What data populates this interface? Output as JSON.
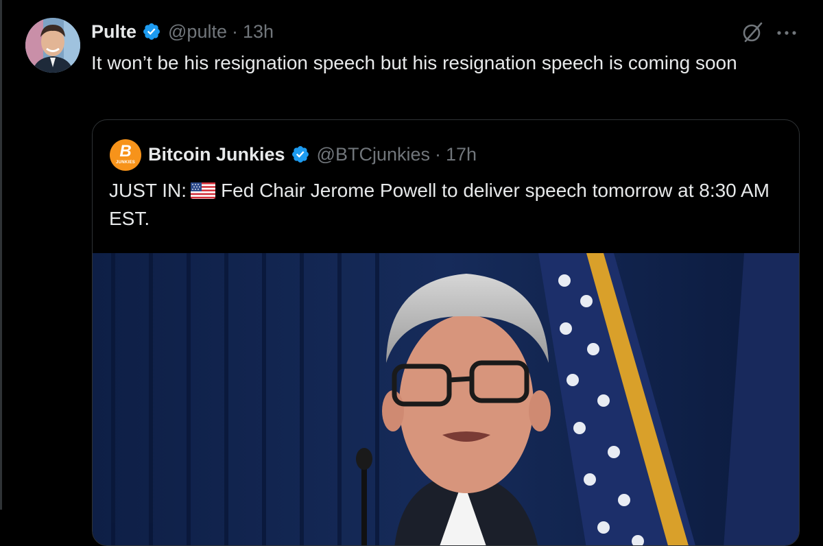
{
  "post": {
    "author_name": "Pulte",
    "handle": "@pulte",
    "separator": "·",
    "time": "13h",
    "text": "It won’t be his resignation speech but his resignation speech is coming soon",
    "icons": [
      "verified-badge-icon",
      "grok-icon",
      "more-icon"
    ]
  },
  "quote": {
    "author_name": "Bitcoin Junkies",
    "avatar_symbol": "B",
    "avatar_caption": "JUNKIES",
    "handle": "@BTCjunkies",
    "separator": "·",
    "time": "17h",
    "text_prefix": "JUST IN:",
    "text_body": "Fed Chair Jerome Powell to deliver speech tomorrow at 8:30 AM EST.",
    "flag_icon": "us-flag-icon"
  },
  "colors": {
    "background": "#000000",
    "text": "#e7e9ea",
    "secondary": "#71767b",
    "verified": "#1d9bf0",
    "border": "#2f3336",
    "bitcoin": "#f7931a"
  }
}
